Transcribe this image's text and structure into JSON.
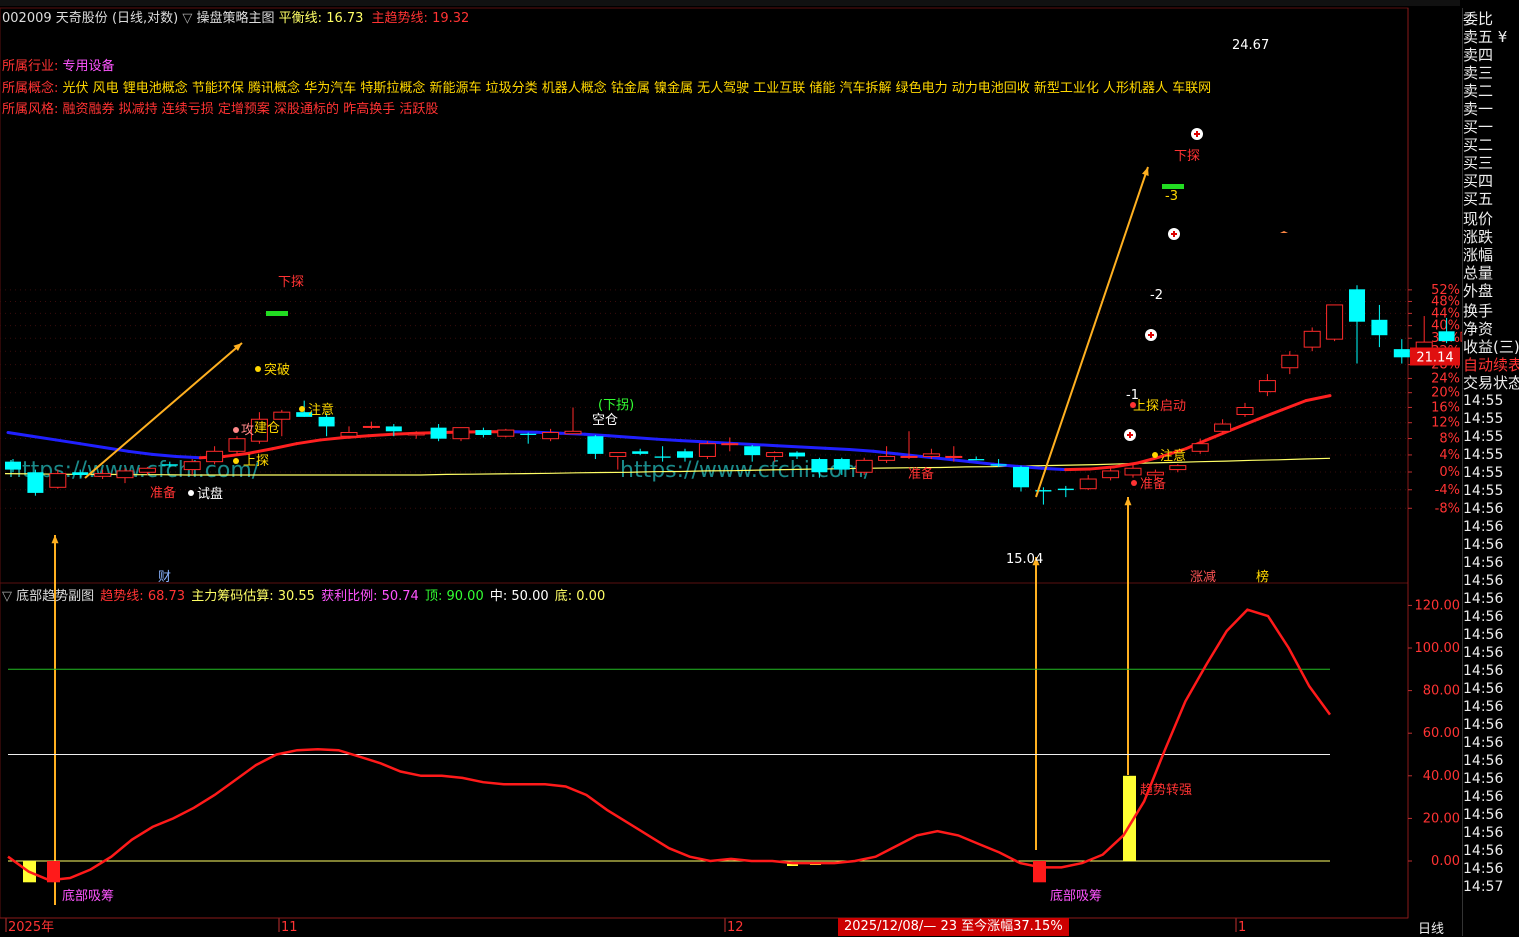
{
  "header": {
    "code": "002009",
    "name": "天奇股份",
    "period_label": "(日线,对数)",
    "main_indicator": "操盘策略主图",
    "balance_label": "平衡线:",
    "balance_value": "16.73",
    "trend_label": "主趋势线:",
    "trend_value": "19.32"
  },
  "info": {
    "industry_label": "所属行业:",
    "industry": "专用设备",
    "concept_label": "所属概念:",
    "concepts": "光伏 风电 锂电池概念 节能环保 腾讯概念 华为汽车 特斯拉概念 新能源车 垃圾分类 机器人概念 钴金属 镍金属 无人驾驶 工业互联 储能 汽车拆解 绿色电力 动力电池回收 新型工业化 人形机器人 车联网",
    "style_label": "所属风格:",
    "styles": "融资融券 拟减持 连续亏损 定增预案 深股通标的 昨高换手 活跃股"
  },
  "sub_header": {
    "name": "底部趋势副图",
    "trend_label": "趋势线:",
    "trend_value": "68.73",
    "chip_label": "主力筹码估算:",
    "chip_value": "30.55",
    "profit_label": "获利比例:",
    "profit_value": "50.74",
    "top_label": "顶:",
    "top_value": "90.00",
    "mid_label": "中:",
    "mid_value": "50.00",
    "bottom_label": "底:",
    "bottom_value": "0.00"
  },
  "right_panel": {
    "items": [
      "委比",
      "卖五 ¥",
      "卖四",
      "卖三",
      "卖二",
      "卖一",
      "买一",
      "买二",
      "买三",
      "买四",
      "买五",
      "现价",
      "涨跌",
      "涨幅",
      "总量",
      "外盘",
      "换手",
      "净资",
      "收益(三)"
    ],
    "auto_label": "自动续表",
    "trade_state": "交易状态",
    "times": [
      "14:55",
      "14:55",
      "14:55",
      "14:55",
      "14:55",
      "14:55",
      "14:56",
      "14:56",
      "14:56",
      "14:56",
      "14:56",
      "14:56",
      "14:56",
      "14:56",
      "14:56",
      "14:56",
      "14:56",
      "14:56",
      "14:56",
      "14:56",
      "14:56",
      "14:56",
      "14:56",
      "14:56",
      "14:56",
      "14:56",
      "14:56",
      "14:57"
    ]
  },
  "bottom": {
    "date_range": "2025/12/08/— 23 至今涨幅37.15%",
    "period_button": "日线",
    "axis_labels": [
      "2025年",
      "11",
      "12",
      "1"
    ]
  },
  "price_marker": "21.14",
  "watermarks": [
    "https://www.cfchi.com/",
    "https://www.cfchi.com/"
  ],
  "colors": {
    "up": "#ff2a2a",
    "down": "#00ffff",
    "trend_up": "#ff2020",
    "trend_down": "#2020ff",
    "balance": "#ffff66",
    "arrow": "#ffb020",
    "sub_line": "#ff1a1a"
  },
  "chart_data": [
    {
      "type": "candlestick",
      "title": "操盘策略主图",
      "yscale": "log",
      "ylim": [
        14.8,
        26.0
      ],
      "y_ticks_pct": [
        "52%",
        "48%",
        "44%",
        "40%",
        "36%",
        "32%",
        "28%",
        "24%",
        "20%",
        "16%",
        "12%",
        "8%",
        "4%",
        "0%",
        "-4%",
        "-8%"
      ],
      "candles": [
        {
          "o": 16.6,
          "h": 16.7,
          "l": 16.2,
          "c": 16.3
        },
        {
          "o": 16.2,
          "h": 16.3,
          "l": 15.35,
          "c": 15.45
        },
        {
          "o": 15.65,
          "h": 16.3,
          "l": 15.6,
          "c": 16.15
        },
        {
          "o": 16.2,
          "h": 16.3,
          "l": 16.0,
          "c": 16.1
        },
        {
          "o": 16.05,
          "h": 16.3,
          "l": 15.95,
          "c": 16.15
        },
        {
          "o": 16.0,
          "h": 16.35,
          "l": 15.8,
          "c": 16.25
        },
        {
          "o": 16.2,
          "h": 16.4,
          "l": 16.1,
          "c": 16.35
        },
        {
          "o": 16.5,
          "h": 16.6,
          "l": 16.4,
          "c": 16.45
        },
        {
          "o": 16.3,
          "h": 16.7,
          "l": 16.1,
          "c": 16.6
        },
        {
          "o": 16.6,
          "h": 17.2,
          "l": 16.5,
          "c": 17.0
        },
        {
          "o": 17.0,
          "h": 17.6,
          "l": 16.9,
          "c": 17.5
        },
        {
          "o": 17.4,
          "h": 18.6,
          "l": 17.3,
          "c": 18.3
        },
        {
          "o": 18.3,
          "h": 18.7,
          "l": 17.6,
          "c": 18.6
        },
        {
          "o": 18.6,
          "h": 19.1,
          "l": 18.4,
          "c": 18.4
        },
        {
          "o": 18.4,
          "h": 18.55,
          "l": 17.6,
          "c": 18.0
        },
        {
          "o": 17.6,
          "h": 18.0,
          "l": 17.5,
          "c": 17.75
        },
        {
          "o": 18.0,
          "h": 18.2,
          "l": 17.9,
          "c": 18.0
        },
        {
          "o": 18.0,
          "h": 18.1,
          "l": 17.6,
          "c": 17.8
        },
        {
          "o": 17.65,
          "h": 17.8,
          "l": 17.5,
          "c": 17.7
        },
        {
          "o": 17.95,
          "h": 18.1,
          "l": 17.4,
          "c": 17.5
        },
        {
          "o": 17.5,
          "h": 17.95,
          "l": 17.4,
          "c": 17.95
        },
        {
          "o": 17.85,
          "h": 17.95,
          "l": 17.55,
          "c": 17.65
        },
        {
          "o": 17.6,
          "h": 17.9,
          "l": 17.55,
          "c": 17.85
        },
        {
          "o": 17.7,
          "h": 17.75,
          "l": 17.3,
          "c": 17.65
        },
        {
          "o": 17.5,
          "h": 17.9,
          "l": 17.4,
          "c": 17.75
        },
        {
          "o": 17.7,
          "h": 18.8,
          "l": 17.7,
          "c": 17.8
        },
        {
          "o": 17.6,
          "h": 17.65,
          "l": 16.7,
          "c": 16.9
        },
        {
          "o": 16.8,
          "h": 16.9,
          "l": 16.3,
          "c": 16.95
        },
        {
          "o": 17.0,
          "h": 17.1,
          "l": 16.85,
          "c": 16.9
        },
        {
          "o": 16.8,
          "h": 17.2,
          "l": 16.6,
          "c": 16.75
        },
        {
          "o": 17.0,
          "h": 17.1,
          "l": 16.6,
          "c": 16.75
        },
        {
          "o": 16.8,
          "h": 17.4,
          "l": 16.7,
          "c": 17.3
        },
        {
          "o": 17.3,
          "h": 17.55,
          "l": 17.0,
          "c": 17.3
        },
        {
          "o": 17.2,
          "h": 17.25,
          "l": 16.6,
          "c": 16.85
        },
        {
          "o": 16.8,
          "h": 17.0,
          "l": 16.6,
          "c": 16.95
        },
        {
          "o": 16.95,
          "h": 17.0,
          "l": 16.7,
          "c": 16.8
        },
        {
          "o": 16.7,
          "h": 16.75,
          "l": 16.0,
          "c": 16.2
        },
        {
          "o": 16.7,
          "h": 16.75,
          "l": 16.1,
          "c": 16.3
        },
        {
          "o": 16.2,
          "h": 16.75,
          "l": 16.1,
          "c": 16.65
        },
        {
          "o": 16.65,
          "h": 17.2,
          "l": 16.55,
          "c": 16.8
        },
        {
          "o": 16.8,
          "h": 17.8,
          "l": 16.7,
          "c": 16.8
        },
        {
          "o": 16.8,
          "h": 17.1,
          "l": 16.7,
          "c": 16.9
        },
        {
          "o": 16.8,
          "h": 17.2,
          "l": 16.6,
          "c": 16.8
        },
        {
          "o": 16.7,
          "h": 16.8,
          "l": 16.65,
          "c": 16.65
        },
        {
          "o": 16.5,
          "h": 16.7,
          "l": 16.4,
          "c": 16.45
        },
        {
          "o": 16.4,
          "h": 16.45,
          "l": 15.5,
          "c": 15.65
        },
        {
          "o": 15.55,
          "h": 15.65,
          "l": 15.04,
          "c": 15.5
        },
        {
          "o": 15.6,
          "h": 15.7,
          "l": 15.3,
          "c": 15.55
        },
        {
          "o": 15.6,
          "h": 16.1,
          "l": 15.55,
          "c": 15.95
        },
        {
          "o": 16.0,
          "h": 16.4,
          "l": 15.9,
          "c": 16.25
        },
        {
          "o": 16.1,
          "h": 16.5,
          "l": 16.0,
          "c": 16.35
        },
        {
          "o": 16.1,
          "h": 16.3,
          "l": 15.9,
          "c": 16.2
        },
        {
          "o": 16.3,
          "h": 16.5,
          "l": 16.2,
          "c": 16.45
        },
        {
          "o": 17.0,
          "h": 17.5,
          "l": 16.9,
          "c": 17.3
        },
        {
          "o": 17.8,
          "h": 18.3,
          "l": 17.7,
          "c": 18.1
        },
        {
          "o": 18.5,
          "h": 19.0,
          "l": 18.4,
          "c": 18.8
        },
        {
          "o": 19.5,
          "h": 20.3,
          "l": 19.3,
          "c": 20.0
        },
        {
          "o": 20.6,
          "h": 21.4,
          "l": 20.3,
          "c": 21.2
        },
        {
          "o": 21.6,
          "h": 22.6,
          "l": 21.4,
          "c": 22.4
        },
        {
          "o": 22.0,
          "h": 23.8,
          "l": 21.9,
          "c": 23.8
        },
        {
          "o": 24.67,
          "h": 24.9,
          "l": 20.8,
          "c": 22.9
        },
        {
          "o": 23.0,
          "h": 23.8,
          "l": 21.6,
          "c": 22.2
        },
        {
          "o": 21.5,
          "h": 22.0,
          "l": 20.8,
          "c": 21.1
        },
        {
          "o": 20.95,
          "h": 23.2,
          "l": 20.9,
          "c": 21.85
        },
        {
          "o": 22.4,
          "h": 23.1,
          "l": 21.8,
          "c": 21.9
        },
        {
          "o": 21.9,
          "h": 23.2,
          "l": 21.8,
          "c": 22.35
        }
      ],
      "balance_line": [
        16.15,
        16.14,
        16.13,
        16.12,
        16.12,
        16.11,
        16.11,
        16.1,
        16.1,
        16.1,
        16.1,
        16.1,
        16.1,
        16.1,
        16.1,
        16.1,
        16.1,
        16.12,
        16.13,
        16.14,
        16.15,
        16.16,
        16.18,
        16.19,
        16.2,
        16.22,
        16.23,
        16.25,
        16.26,
        16.28,
        16.3,
        16.32,
        16.33,
        16.35,
        16.36,
        16.37,
        16.38,
        16.4,
        16.41,
        16.43,
        16.45,
        16.47,
        16.49,
        16.52,
        16.55,
        16.57,
        16.6,
        16.62,
        16.65,
        16.67,
        16.7,
        16.73
      ],
      "trend_line": [
        17.75,
        17.6,
        17.45,
        17.3,
        17.15,
        17.0,
        16.88,
        16.8,
        16.75,
        16.8,
        16.92,
        17.1,
        17.3,
        17.45,
        17.55,
        17.62,
        17.68,
        17.72,
        17.75,
        17.77,
        17.78,
        17.78,
        17.76,
        17.72,
        17.68,
        17.62,
        17.55,
        17.48,
        17.42,
        17.37,
        17.32,
        17.27,
        17.22,
        17.17,
        17.12,
        17.07,
        17.0,
        16.9,
        16.8,
        16.7,
        16.6,
        16.5,
        16.42,
        16.35,
        16.3,
        16.32,
        16.4,
        16.55,
        16.8,
        17.1,
        17.5,
        17.9,
        18.3,
        18.7,
        19.1,
        19.32
      ],
      "annotations": [
        "24.67",
        "15.04",
        "准备",
        "试盘",
        "上探",
        "攻",
        "建仓",
        "突破",
        "注意",
        "下探",
        "(下拐)",
        "空仓",
        "准备",
        "准备",
        "注意",
        "上探",
        "启动",
        "下探",
        "-1",
        "-2",
        "-3",
        "财",
        "涨减",
        "榜"
      ]
    },
    {
      "type": "line",
      "title": "底部趋势副图",
      "ylim": [
        -10,
        128
      ],
      "y_ticks": [
        "120.00",
        "100.00",
        "80.00",
        "60.00",
        "40.00",
        "20.00",
        "0.00"
      ],
      "hlines": [
        90,
        50,
        0
      ],
      "trend": [
        2,
        -5,
        -9,
        -8,
        -4,
        2,
        10,
        16,
        20,
        25,
        31,
        38,
        45,
        50,
        52,
        52.5,
        52,
        49,
        46,
        42,
        40,
        40,
        39,
        37,
        36,
        36,
        36,
        35,
        31,
        24,
        18,
        12,
        6,
        2,
        0,
        1,
        0,
        0,
        -1,
        -1,
        -1,
        0,
        2,
        7,
        12,
        14,
        12,
        8,
        4,
        -1,
        -3,
        -3,
        -1,
        3,
        12,
        28,
        52,
        75,
        92,
        108,
        118,
        115,
        100,
        82,
        68.73
      ],
      "bars": [
        {
          "label": "底部吸筹",
          "value": -10
        },
        {
          "label": "底部吸筹",
          "value": -10
        },
        {
          "label": "趋势转强",
          "value": 40
        }
      ]
    }
  ]
}
